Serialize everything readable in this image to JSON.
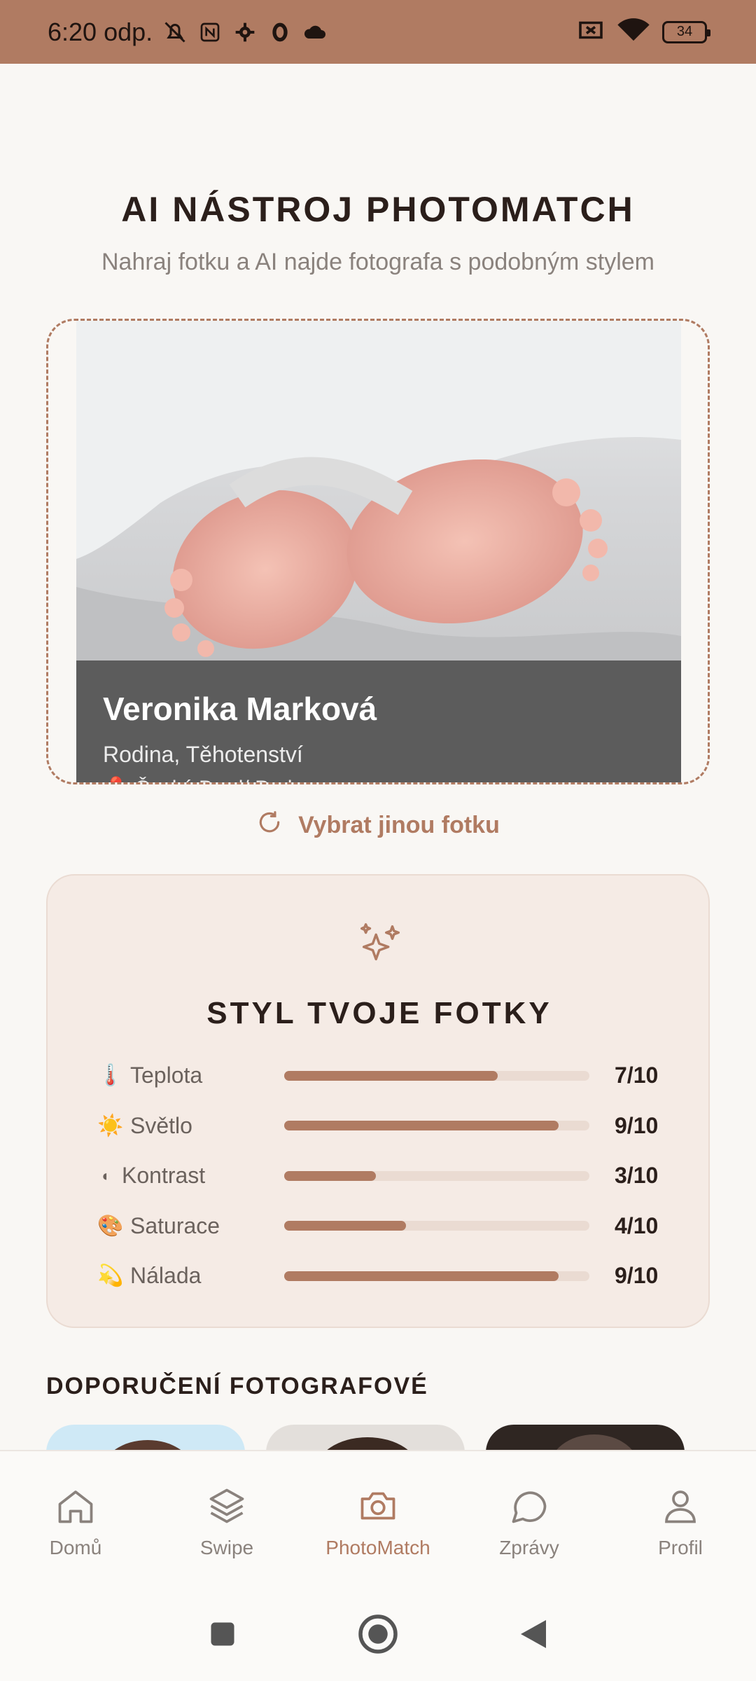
{
  "status_bar": {
    "time": "6:20 odp.",
    "battery": "34"
  },
  "header": {
    "title": "AI NÁSTROJ PHOTOMATCH",
    "subtitle": "Nahraj fotku a AI najde fotografa s podobným stylem"
  },
  "photo_card": {
    "name": "Veronika Marková",
    "categories": "Rodina, Těhotenství",
    "location": "Český Brod/ Praha"
  },
  "change_photo_label": "Vybrat jinou fotku",
  "style": {
    "title": "STYL TVOJE FOTKY",
    "metrics": [
      {
        "emoji": "🌡️",
        "label": "Teplota",
        "value": "7/10",
        "score": 7
      },
      {
        "emoji": "☀️",
        "label": "Světlo",
        "value": "9/10",
        "score": 9
      },
      {
        "emoji": "◐",
        "label": "Kontrast",
        "value": "3/10",
        "score": 3
      },
      {
        "emoji": "🎨",
        "label": "Saturace",
        "value": "4/10",
        "score": 4
      },
      {
        "emoji": "💫",
        "label": "Nálada",
        "value": "9/10",
        "score": 9
      }
    ]
  },
  "recommended": {
    "title": "DOPORUČENÍ FOTOGRAFOVÉ"
  },
  "nav": {
    "items": [
      {
        "label": "Domů",
        "icon": "home-icon"
      },
      {
        "label": "Swipe",
        "icon": "layers-icon"
      },
      {
        "label": "PhotoMatch",
        "icon": "camera-icon"
      },
      {
        "label": "Zprávy",
        "icon": "chat-icon"
      },
      {
        "label": "Profil",
        "icon": "user-icon"
      }
    ],
    "active": "PhotoMatch"
  },
  "colors": {
    "accent": "#b07b62",
    "background": "#f9f7f4",
    "card": "#f5ebe5"
  }
}
